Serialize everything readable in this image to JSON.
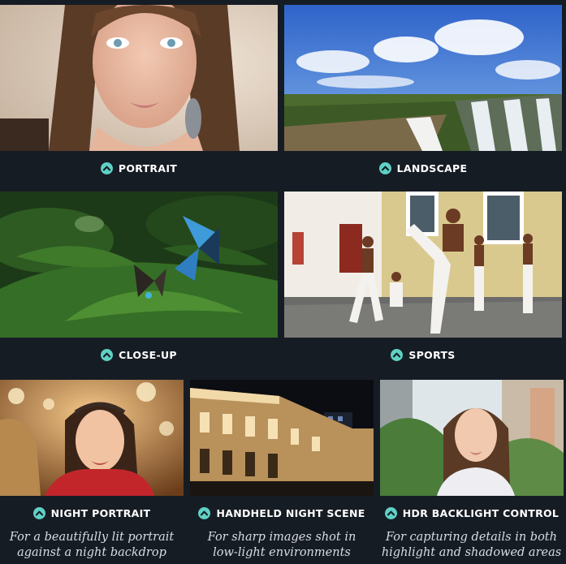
{
  "colors": {
    "background": "#161c24",
    "accent": "#5fd1c4",
    "text": "#ffffff",
    "description": "#d9dde2"
  },
  "icon": "mode-chevron-up-icon",
  "modes": [
    {
      "label": "PORTRAIT"
    },
    {
      "label": "LANDSCAPE"
    },
    {
      "label": "CLOSE-UP"
    },
    {
      "label": "SPORTS"
    },
    {
      "label": "NIGHT PORTRAIT",
      "description": [
        "For a beautifully lit portrait",
        "against a night backdrop"
      ]
    },
    {
      "label": "HANDHELD NIGHT SCENE",
      "description": [
        "For sharp images shot in",
        "low-light environments"
      ]
    },
    {
      "label": "HDR BACKLIGHT CONTROL",
      "description": [
        "For capturing details in both",
        "highlight and shadowed areas"
      ]
    }
  ]
}
